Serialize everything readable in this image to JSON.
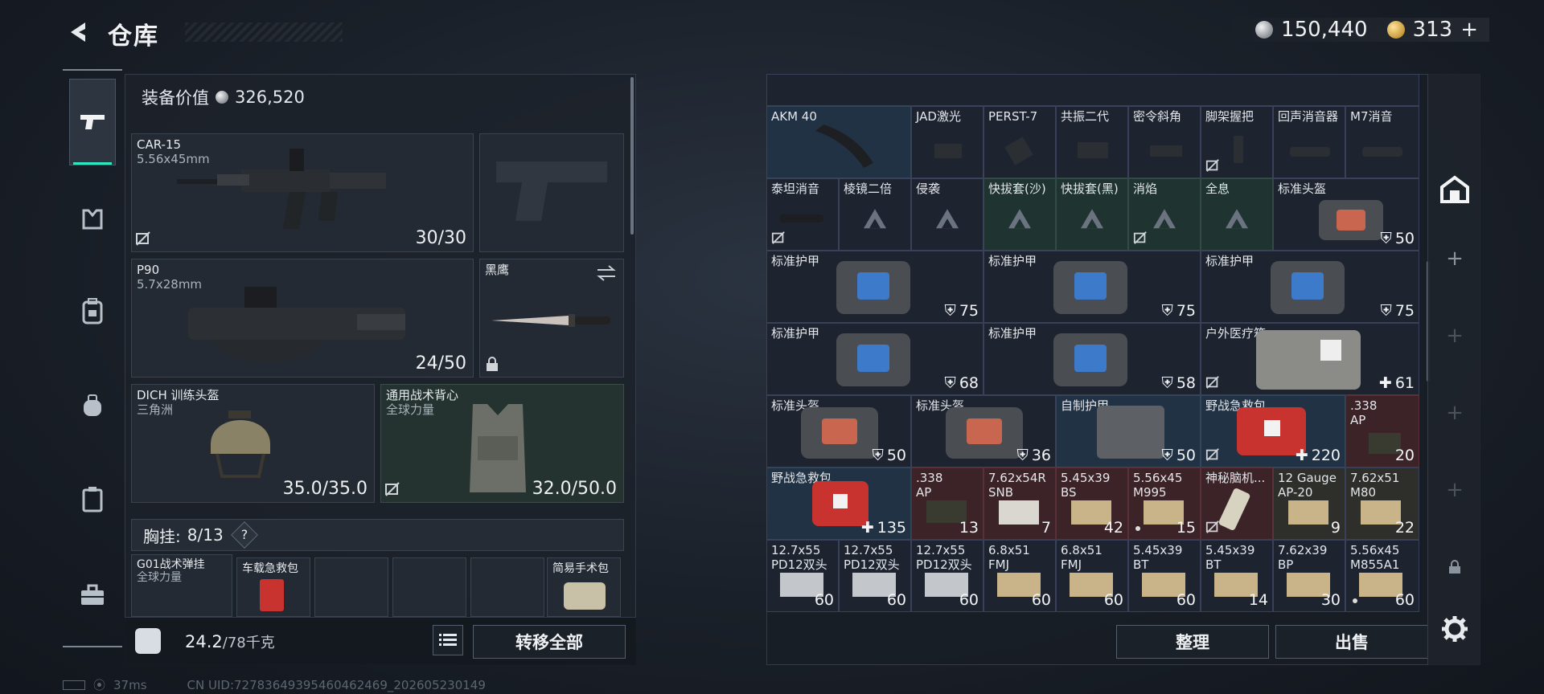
{
  "header": {
    "title": "仓库",
    "silver": "150,440",
    "gold": "313",
    "gold_plus": "+"
  },
  "equipment": {
    "value_label": "装备价值",
    "value": "326,520",
    "primary": {
      "name": "CAR-15",
      "caliber": "5.56x45mm",
      "ammo": "30/30"
    },
    "secondary": {
      "name": "P90",
      "caliber": "5.7x28mm",
      "ammo": "24/50"
    },
    "melee": {
      "name": "黑鹰"
    },
    "helmet": {
      "name": "DICH 训练头盔",
      "faction": "三角洲",
      "durability": "35.0/35.0"
    },
    "armor": {
      "name": "通用战术背心",
      "faction": "全球力量",
      "durability": "32.0/50.0"
    },
    "rig": {
      "label": "胸挂:",
      "capacity": "8/13",
      "help": "?"
    },
    "rig_items": [
      {
        "name": "G01战术弹挂",
        "sub": "全球力量"
      },
      {
        "name": "车载急救包"
      },
      {
        "name": "简易手术包"
      }
    ],
    "weight": "24.2",
    "weight_max": "/78千克",
    "transfer_all": "转移全部"
  },
  "grid": {
    "rows": [
      [
        {
          "name": "AKM 40",
          "style": "blue",
          "span": 2
        },
        {
          "name": "JAD激光",
          "style": "dark"
        },
        {
          "name": "PERST-7",
          "style": "dark"
        },
        {
          "name": "共振二代",
          "style": "dark"
        },
        {
          "name": "密令斜角",
          "style": "dark"
        },
        {
          "name": "脚架握把",
          "style": "dark",
          "nosell": true
        },
        {
          "name": "回声消音器",
          "style": "dark"
        },
        {
          "name": "M7消音",
          "style": "dark"
        }
      ],
      [
        {
          "name": "泰坦消音",
          "style": "dark",
          "nosell": true
        },
        {
          "name": "棱镜二倍",
          "style": "dark",
          "tri": true
        },
        {
          "name": "侵袭",
          "style": "dark",
          "tri": true
        },
        {
          "name": "快拔套(沙)",
          "style": "green",
          "tri": true
        },
        {
          "name": "快拔套(黑)",
          "style": "green",
          "tri": true
        },
        {
          "name": "消焰",
          "style": "green",
          "tri": true,
          "nosell": true
        },
        {
          "name": "全息",
          "style": "green",
          "tri": true
        },
        {
          "name": "标准头盔",
          "style": "dark",
          "val": "50",
          "icon": "shield"
        }
      ]
    ],
    "armor_rows": [
      [
        {
          "name": "标准护甲",
          "val": "75"
        },
        {
          "name": "标准护甲",
          "val": "75"
        },
        {
          "name": "标准护甲",
          "val": "75"
        }
      ],
      [
        {
          "name": "标准护甲",
          "val": "68"
        },
        {
          "name": "标准护甲",
          "val": "58"
        },
        {
          "name": "户外医疗箱",
          "val": "61",
          "icon": "plus",
          "nosell": true
        }
      ]
    ],
    "row5": [
      {
        "name": "标准头盔",
        "val": "50",
        "icon": "shield"
      },
      {
        "name": "标准头盔",
        "val": "36",
        "icon": "shield"
      },
      {
        "name": "自制护甲",
        "val": "50",
        "icon": "shield"
      },
      {
        "name": "野战急救包",
        "val": "220",
        "icon": "plus",
        "nosell": true
      },
      {
        "name": ".338",
        "name2": "AP",
        "val": "20"
      }
    ],
    "row6": [
      {
        "name": "野战急救包",
        "val": "135",
        "icon": "plus"
      },
      {
        "name": ".338",
        "name2": "AP",
        "val": "13"
      },
      {
        "name": "7.62x54R",
        "name2": "SNB",
        "val": "7"
      },
      {
        "name": "5.45x39",
        "name2": "BS",
        "val": "42"
      },
      {
        "name": "5.56x45",
        "name2": "M995",
        "val": "15",
        "dot": true
      },
      {
        "name": "神秘脑机...",
        "val": "",
        "nosell": true
      },
      {
        "name": "12 Gauge",
        "name2": "AP-20",
        "val": "9"
      },
      {
        "name": "7.62x51",
        "name2": "M80",
        "val": "22"
      }
    ],
    "row7": [
      {
        "name": "12.7x55",
        "name2": "PD12双头",
        "val": "60"
      },
      {
        "name": "12.7x55",
        "name2": "PD12双头",
        "val": "60"
      },
      {
        "name": "12.7x55",
        "name2": "PD12双头",
        "val": "60"
      },
      {
        "name": "6.8x51",
        "name2": "FMJ",
        "val": "60"
      },
      {
        "name": "6.8x51",
        "name2": "FMJ",
        "val": "60"
      },
      {
        "name": "5.45x39",
        "name2": "BT",
        "val": "60"
      },
      {
        "name": "5.45x39",
        "name2": "BT",
        "val": "14"
      },
      {
        "name": "7.62x39",
        "name2": "BP",
        "val": "30"
      },
      {
        "name": "5.56x45",
        "name2": "M855A1",
        "val": "60",
        "dot": true
      }
    ]
  },
  "actions": {
    "sort": "整理",
    "sell": "出售"
  },
  "footer": {
    "ping": "37ms",
    "uid": "CN UID:72783649395460462469_202605230149"
  },
  "colors": {
    "accent": "#2fe6c0",
    "panel": "#1c222a"
  }
}
